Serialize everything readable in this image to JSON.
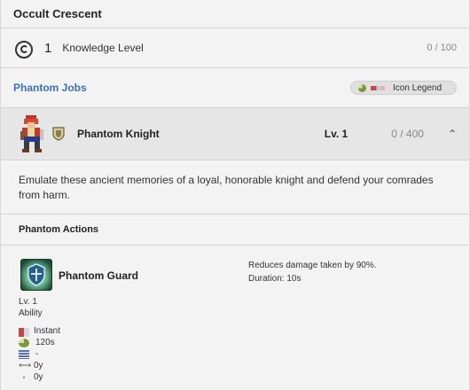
{
  "panel_title": "Occult Crescent",
  "knowledge": {
    "level": "1",
    "label": "Knowledge Level",
    "progress": "0 / 100"
  },
  "jobs_section": {
    "title": "Phantom Jobs",
    "legend_label": "Icon Legend"
  },
  "job": {
    "name": "Phantom Knight",
    "level": "Lv. 1",
    "exp": "0 / 400",
    "description": "Emulate these ancient memories of a loyal, honorable knight and defend your comrades from harm."
  },
  "actions_title": "Phantom Actions",
  "action": {
    "name": "Phantom Guard",
    "description_line1": "Reduces damage taken by 90%.",
    "description_line2": "Duration: 10s",
    "level": "Lv. 1",
    "type": "Ability",
    "cast": "Instant",
    "recast": "120s",
    "mp": "-",
    "range": "0y",
    "radius": "0y"
  },
  "icons": {
    "knowledge": "crescent-icon",
    "legend": "legend-icons",
    "job_crest": "shield-crest-icon",
    "collapse": "chevron-up-icon",
    "cast": "cast-bar-icon",
    "recast": "recast-pie-icon",
    "mp": "mp-cost-icon",
    "range": "range-arrow-icon",
    "radius": "radius-dot-icon"
  },
  "colors": {
    "accent": "#3f6fb5",
    "job_row_bg": "#e6e6e6",
    "panel_bg": "#f3f3f3"
  }
}
